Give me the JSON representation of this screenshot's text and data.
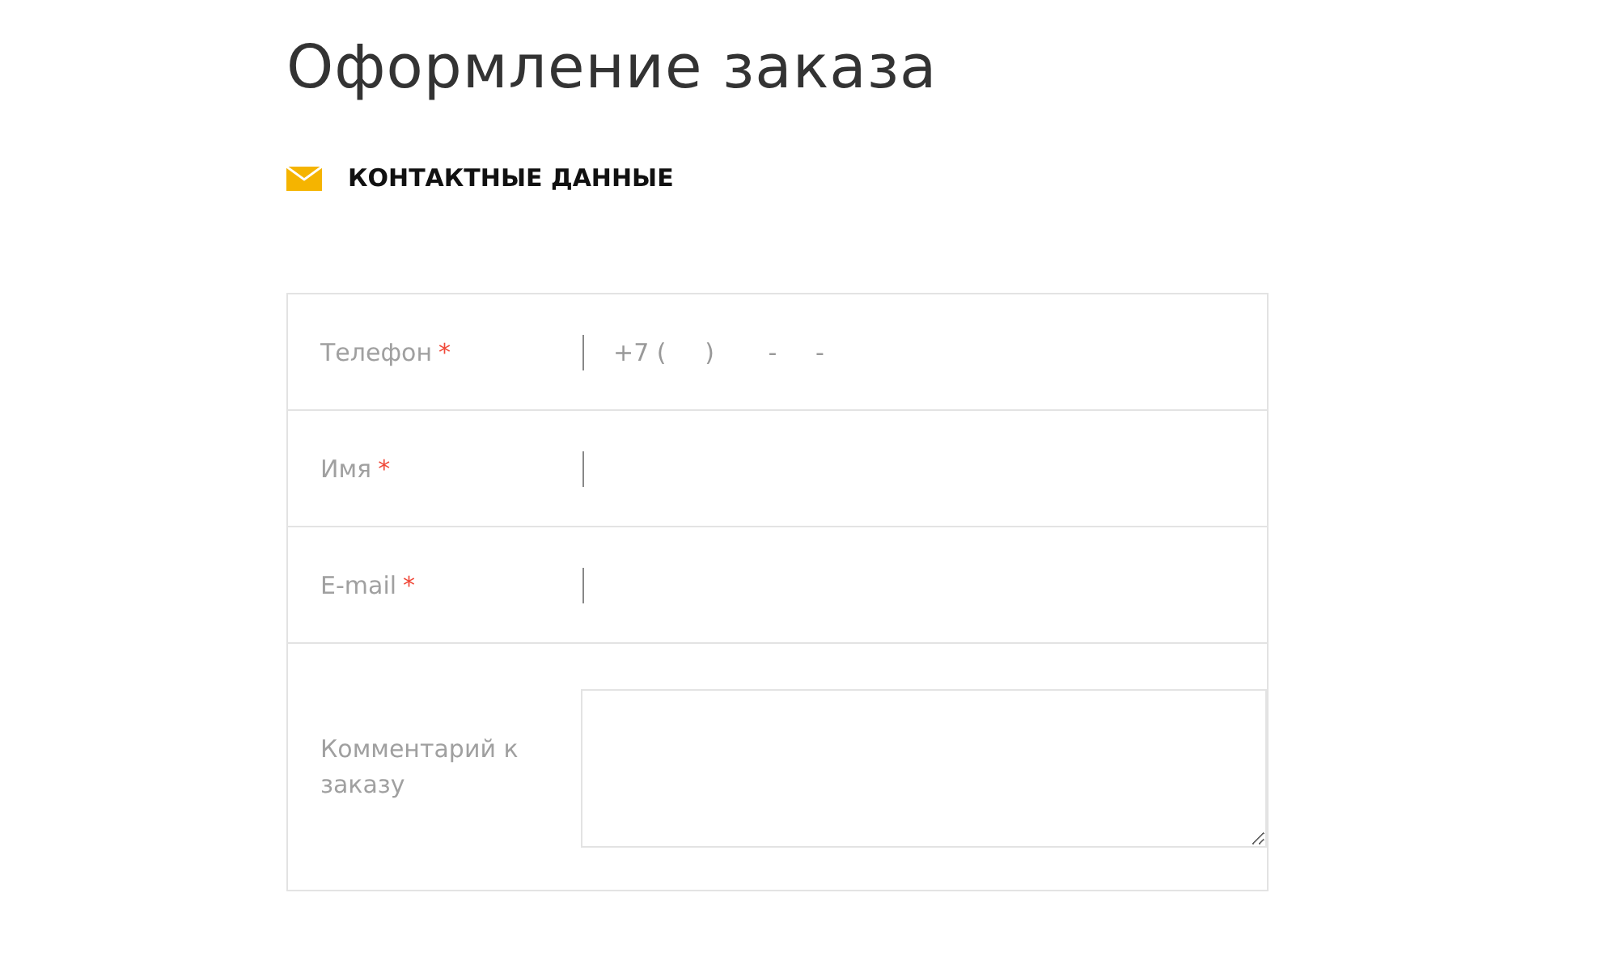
{
  "title": "Оформление заказа",
  "section": {
    "title": "КОНТАКТНЫЕ ДАННЫЕ"
  },
  "fields": [
    {
      "kind": "line",
      "label": "Телефон",
      "required_mark": "*",
      "placeholder": "+7 (     )       -     -"
    },
    {
      "kind": "line",
      "label": "Имя",
      "required_mark": "*"
    },
    {
      "kind": "line",
      "label": "E-mail",
      "required_mark": "*"
    },
    {
      "kind": "textarea",
      "label": "Комментарий к заказу"
    }
  ]
}
